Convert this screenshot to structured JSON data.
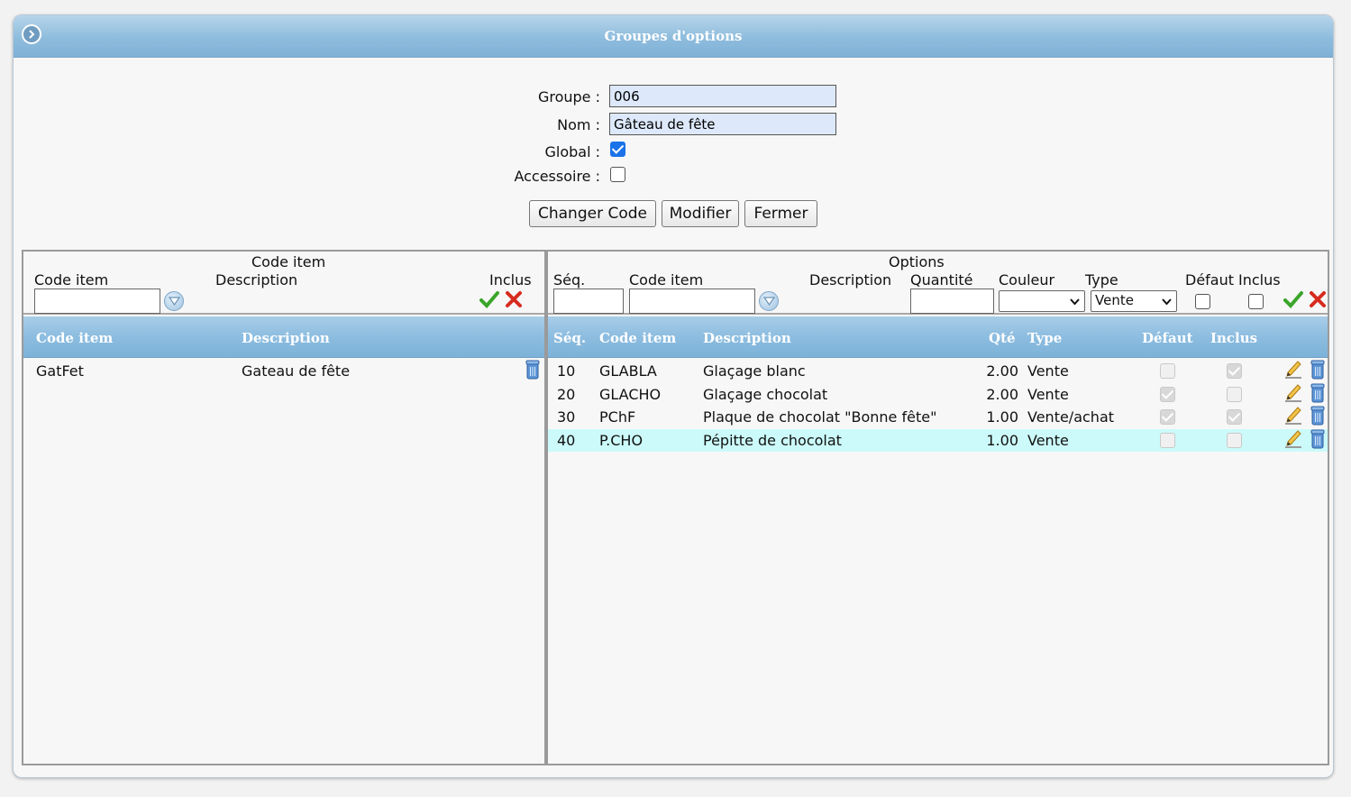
{
  "window": {
    "title": "Groupes d'options"
  },
  "form": {
    "groupe": {
      "label": "Groupe :",
      "value": "006"
    },
    "nom": {
      "label": "Nom :",
      "value": "Gâteau de fête"
    },
    "global": {
      "label": "Global :",
      "checked": true
    },
    "accessoire": {
      "label": "Accessoire :",
      "checked": false
    },
    "buttons": {
      "change_code": "Changer Code",
      "modify": "Modifier",
      "close": "Fermer"
    }
  },
  "left_panel": {
    "filter": {
      "group_title": "Code item",
      "code_label": "Code item",
      "description_label": "Description",
      "inclus_label": "Inclus"
    },
    "columns": {
      "code": "Code item",
      "description": "Description"
    },
    "rows": [
      {
        "code": "GatFet",
        "description": "Gateau de fête"
      }
    ]
  },
  "right_panel": {
    "filter": {
      "group_title": "Options",
      "seq_label": "Séq.",
      "code_label": "Code item",
      "description_label": "Description",
      "quantite_label": "Quantité",
      "couleur_label": "Couleur",
      "couleur_value": "",
      "type_label": "Type",
      "type_value": "Vente",
      "defaut_label": "Défaut",
      "inclus_label": "Inclus"
    },
    "columns": {
      "seq": "Séq.",
      "code": "Code item",
      "description": "Description",
      "qte": "Qté",
      "type": "Type",
      "defaut": "Défaut",
      "inclus": "Inclus"
    },
    "rows": [
      {
        "seq": "10",
        "code": "GLABLA",
        "description": "Glaçage blanc",
        "qte": "2.00",
        "type": "Vente",
        "defaut": false,
        "inclus": true
      },
      {
        "seq": "20",
        "code": "GLACHO",
        "description": "Glaçage chocolat",
        "qte": "2.00",
        "type": "Vente",
        "defaut": true,
        "inclus": false
      },
      {
        "seq": "30",
        "code": "PChF",
        "description": "Plaque de chocolat \"Bonne fête\"",
        "qte": "1.00",
        "type": "Vente/achat",
        "defaut": true,
        "inclus": true
      },
      {
        "seq": "40",
        "code": "P.CHO",
        "description": "Pépitte de chocolat",
        "qte": "1.00",
        "type": "Vente",
        "defaut": false,
        "inclus": false
      }
    ],
    "selected_row": 3
  },
  "colors": {
    "header_blue": "#8ebcdd",
    "selected_row": "#ccfafa",
    "field_bg": "#dde9fa",
    "check_green": "#3aa52a",
    "cancel_red": "#d62b1e"
  },
  "icons": [
    "collapse-arrow-icon",
    "dropdown-circle-icon",
    "green-check-icon",
    "red-x-icon",
    "trash-can-icon",
    "pencil-edit-icon"
  ]
}
